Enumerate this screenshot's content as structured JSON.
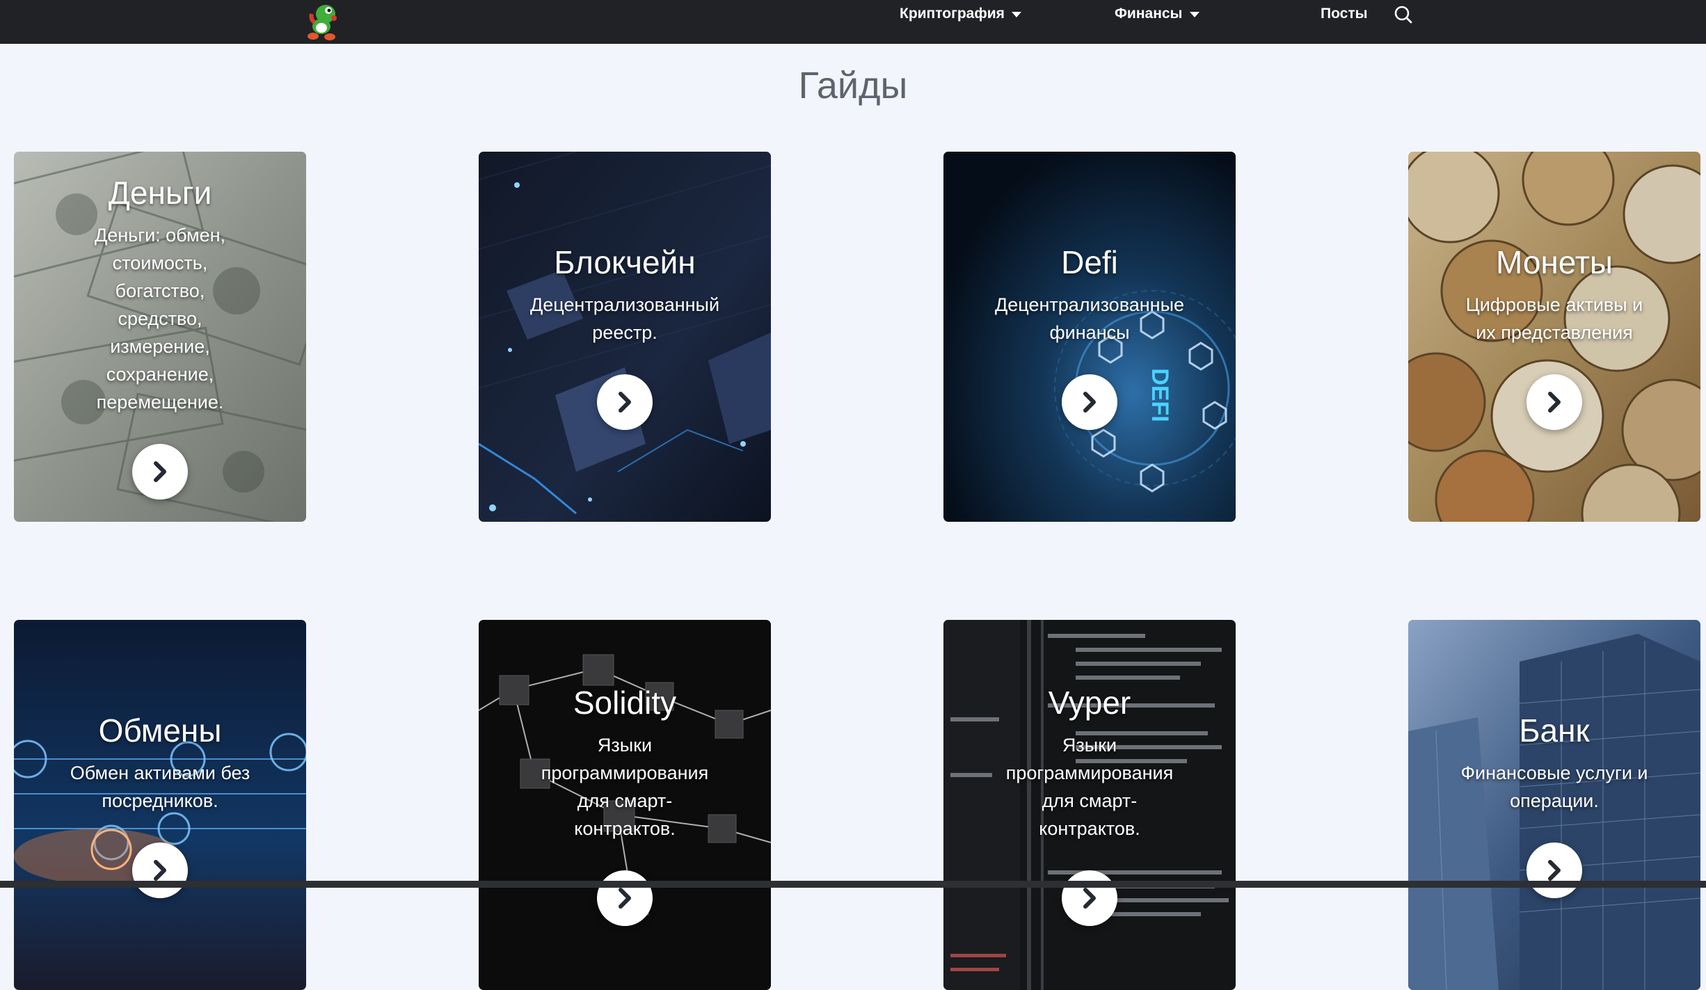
{
  "nav": {
    "items": [
      {
        "label": "Криптография",
        "has_dropdown": true
      },
      {
        "label": "Финансы",
        "has_dropdown": true
      },
      {
        "label": "Посты",
        "has_dropdown": false
      }
    ],
    "icons": {
      "logo": "yoshi-logo-icon",
      "search": "search-icon",
      "dropdown": "caret-down-icon"
    }
  },
  "page": {
    "title": "Гайды"
  },
  "cards": [
    {
      "title": "Деньги",
      "description": "Деньги: обмен, стоимость, богатство, средство, измерение, сохранение, перемещение.",
      "theme": "banknotes"
    },
    {
      "title": "Блокчейн",
      "description": "Децентрализованный реестр.",
      "theme": "blockchain"
    },
    {
      "title": "Defi",
      "description": "Децентрализованные финансы",
      "theme": "defi"
    },
    {
      "title": "Монеты",
      "description": "Цифровые активы и их представления",
      "theme": "coins"
    },
    {
      "title": "Обмены",
      "description": "Обмен активами без посредников.",
      "theme": "exchange"
    },
    {
      "title": "Solidity",
      "description": "Языки программирования для смарт-контрактов.",
      "theme": "cubes"
    },
    {
      "title": "Vyper",
      "description": "Языки программирования для смарт-контрактов.",
      "theme": "code"
    },
    {
      "title": "Банк",
      "description": "Финансовые услуги и операции.",
      "theme": "building"
    }
  ],
  "colors": {
    "navbar": "#212226",
    "background": "#f3f5fc",
    "title": "#5e6370",
    "card_text": "#ffffff"
  }
}
